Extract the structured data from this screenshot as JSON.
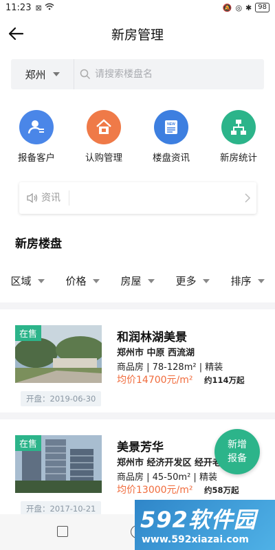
{
  "status_bar": {
    "time": "11:23",
    "battery": "98"
  },
  "nav": {
    "title": "新房管理"
  },
  "search": {
    "city": "郑州",
    "placeholder": "请搜索楼盘名"
  },
  "quick_actions": [
    {
      "label": "报备客户",
      "color": "#4a86e8",
      "icon": "person-card-icon"
    },
    {
      "label": "认购管理",
      "color": "#ef7a48",
      "icon": "house-icon"
    },
    {
      "label": "楼盘资讯",
      "color": "#3d7fe0",
      "icon": "news-icon"
    },
    {
      "label": "新房统计",
      "color": "#2cb48a",
      "icon": "hierarchy-icon"
    }
  ],
  "news": {
    "label": "资讯"
  },
  "section": {
    "title": "新房楼盘"
  },
  "filters": [
    "区域",
    "价格",
    "房屋",
    "更多",
    "排序"
  ],
  "listings": [
    {
      "tag": "在售",
      "name": "和润林湖美景",
      "location": "郑州市 中原 西流湖",
      "meta": "商品房 | 78-128m² | 精装",
      "price": "均价14700元/m²",
      "total": "约114万起",
      "open_date": "开盘：2019-06-30"
    },
    {
      "tag": "在售",
      "name": "美景芳华",
      "location": "郑州市 经济开发区 经开老",
      "meta": "商品房 | 45-50m² | 精装",
      "price": "均价13000元/m²",
      "total": "约58万起",
      "open_date": "开盘：2017-10-21"
    }
  ],
  "fab": {
    "line1": "新增",
    "line2": "报备"
  },
  "watermark": {
    "main": "592软件园",
    "url": "www.592xiazai.com"
  },
  "colors": {
    "accent": "#2cb48a",
    "price": "#f06b3c"
  }
}
